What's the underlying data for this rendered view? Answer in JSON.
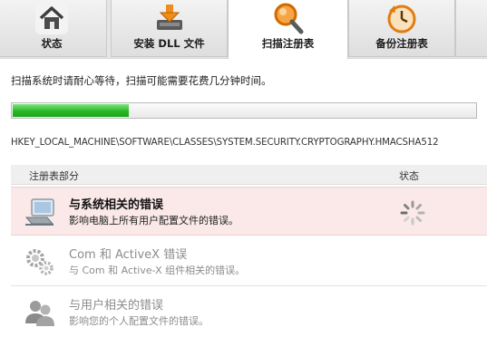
{
  "tabs": [
    {
      "label": "状态",
      "icon": "home-icon"
    },
    {
      "label": "安装 DLL 文件",
      "icon": "download-drive-icon"
    },
    {
      "label": "扫描注册表",
      "icon": "magnifier-icon"
    },
    {
      "label": "备份注册表",
      "icon": "backup-clock-icon"
    }
  ],
  "scan": {
    "intro": "扫描系统时请耐心等待，扫描可能需要花费几分钟时间。",
    "progress_fraction": 0.25,
    "current_path": "HKEY_LOCAL_MACHINE\\SOFTWARE\\CLASSES\\SYSTEM.SECURITY.CRYPTOGRAPHY.HMACSHA512"
  },
  "table": {
    "col_section": "注册表部分",
    "col_status": "状态",
    "rows": [
      {
        "title": "与系统相关的错误",
        "desc": "影响电脑上所有用户配置文件的错误。",
        "icon": "computer-icon",
        "status": "scanning"
      },
      {
        "title": "Com 和  ActiveX 错误",
        "desc": "与 Com 和  Active-X 组件相关的错误。",
        "icon": "gears-icon",
        "status": "pending"
      },
      {
        "title": "与用户相关的错误",
        "desc": "影响您的个人配置文件的错误。",
        "icon": "users-icon",
        "status": "pending"
      }
    ]
  },
  "colors": {
    "progress": "#28b828",
    "active_row": "#fbe9e9",
    "tab_active": "#ffffff"
  }
}
